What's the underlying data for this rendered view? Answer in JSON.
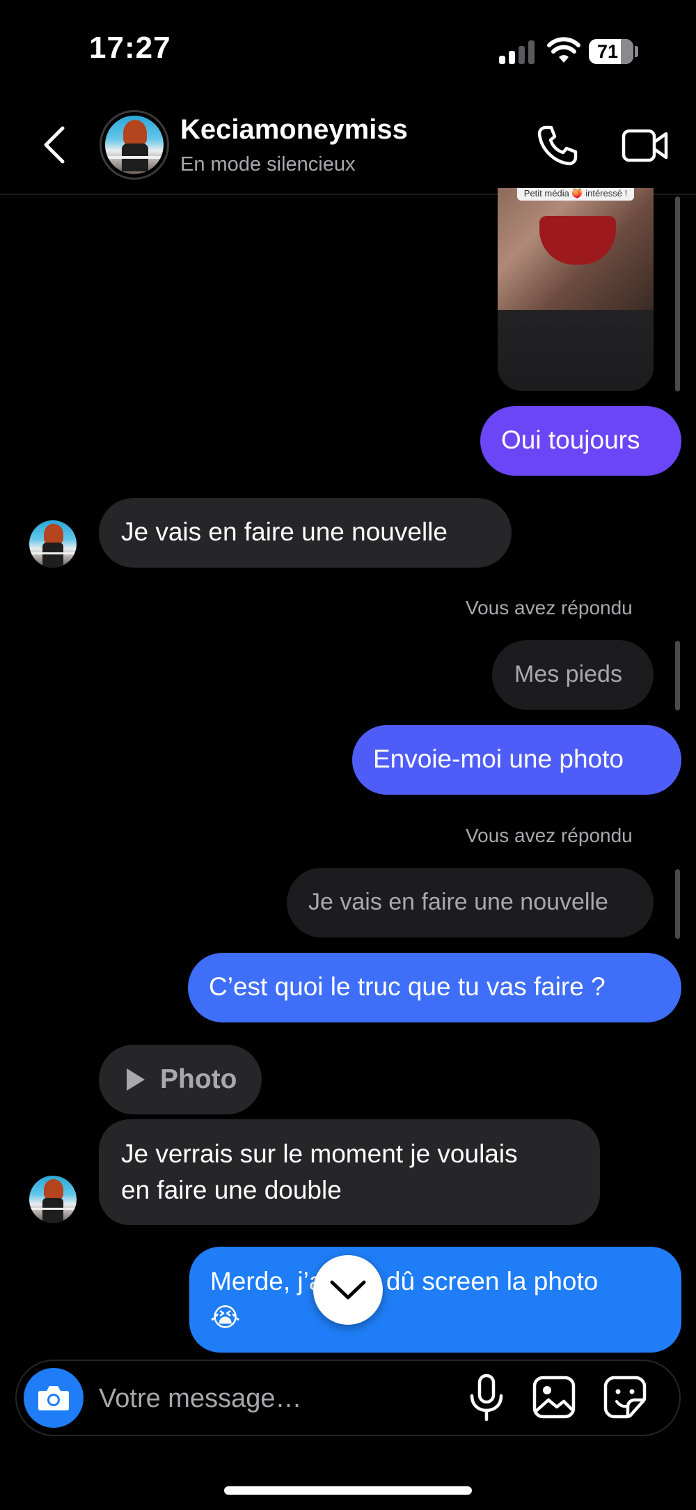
{
  "status_bar": {
    "time": "17:27",
    "battery": "71"
  },
  "header": {
    "contact_name": "Keciamoneymiss",
    "status": "En mode silencieux",
    "back_icon": "chevron-left-icon",
    "call_icon": "phone-icon",
    "video_icon": "video-camera-icon"
  },
  "shared_media": {
    "caption": "Petit média 🍑 intéressé !"
  },
  "messages": [
    {
      "side": "out",
      "text": "Oui toujours"
    },
    {
      "side": "in",
      "text": "Je vais en faire une nouvelle"
    },
    {
      "side": "out",
      "replied_label": "Vous avez répondu",
      "replied_to": "Mes pieds",
      "text": "Envoie-moi une photo"
    },
    {
      "side": "out",
      "replied_label": "Vous avez répondu",
      "replied_to": "Je vais en faire une nouvelle",
      "text": "C’est quoi le truc que tu vas faire ?"
    },
    {
      "side": "in",
      "attachment": "Photo",
      "text_line1": "Je verrais sur le moment je voulais",
      "text_line2": "en faire une double"
    },
    {
      "side": "out",
      "text_line1": "Merde, j’aurais dû screen la photo",
      "text_line2": "😭"
    }
  ],
  "composer": {
    "placeholder": "Votre message…"
  },
  "colors": {
    "accent_blue": "#1f7ef7",
    "purple": "#6b46f7"
  }
}
